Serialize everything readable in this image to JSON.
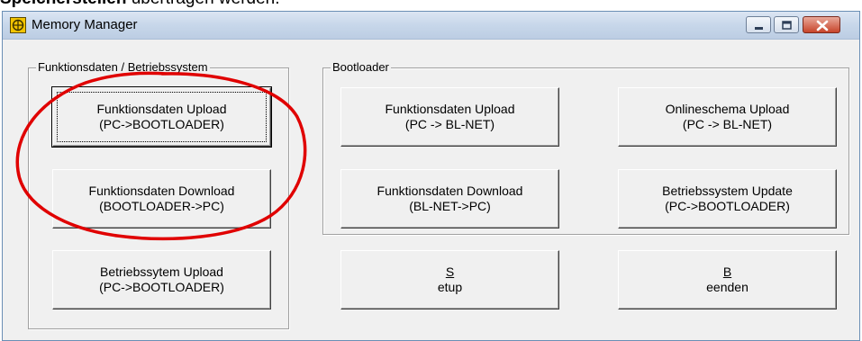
{
  "caption": {
    "bold": "Speicherstellen",
    "rest": " übertragen werden."
  },
  "window": {
    "title": "Memory Manager",
    "icon": "app-icon",
    "controls": [
      "minimize-icon",
      "maximize-icon",
      "close-icon"
    ]
  },
  "groups": {
    "left": {
      "label": "Funktionsdaten / Betriebssystem",
      "buttons": [
        {
          "line1": "Funktionsdaten Upload",
          "line2": "(PC->BOOTLOADER)"
        },
        {
          "line1": "Funktionsdaten Download",
          "line2": "(BOOTLOADER->PC)"
        }
      ]
    },
    "bootloader": {
      "label": "Bootloader",
      "buttons": [
        {
          "line1": "Funktionsdaten Upload",
          "line2": "(PC -> BL-NET)"
        },
        {
          "line1": "Onlineschema Upload",
          "line2": "(PC -> BL-NET)"
        },
        {
          "line1": "Funktionsdaten Download",
          "line2": "(BL-NET->PC)"
        },
        {
          "line1": "Betriebssystem Update",
          "line2": "(PC->BOOTLOADER)"
        }
      ]
    }
  },
  "bottom": {
    "os_upload": {
      "line1": "Betriebssytem Upload",
      "line2": "(PC->BOOTLOADER)"
    },
    "setup": {
      "mnemonic": "S",
      "rest": "etup"
    },
    "exit": {
      "mnemonic": "B",
      "rest": "eenden"
    }
  },
  "colors": {
    "annotation_ellipse": "#e00000",
    "titlebar": "#c7d7ea",
    "close_button": "#c7442a"
  }
}
